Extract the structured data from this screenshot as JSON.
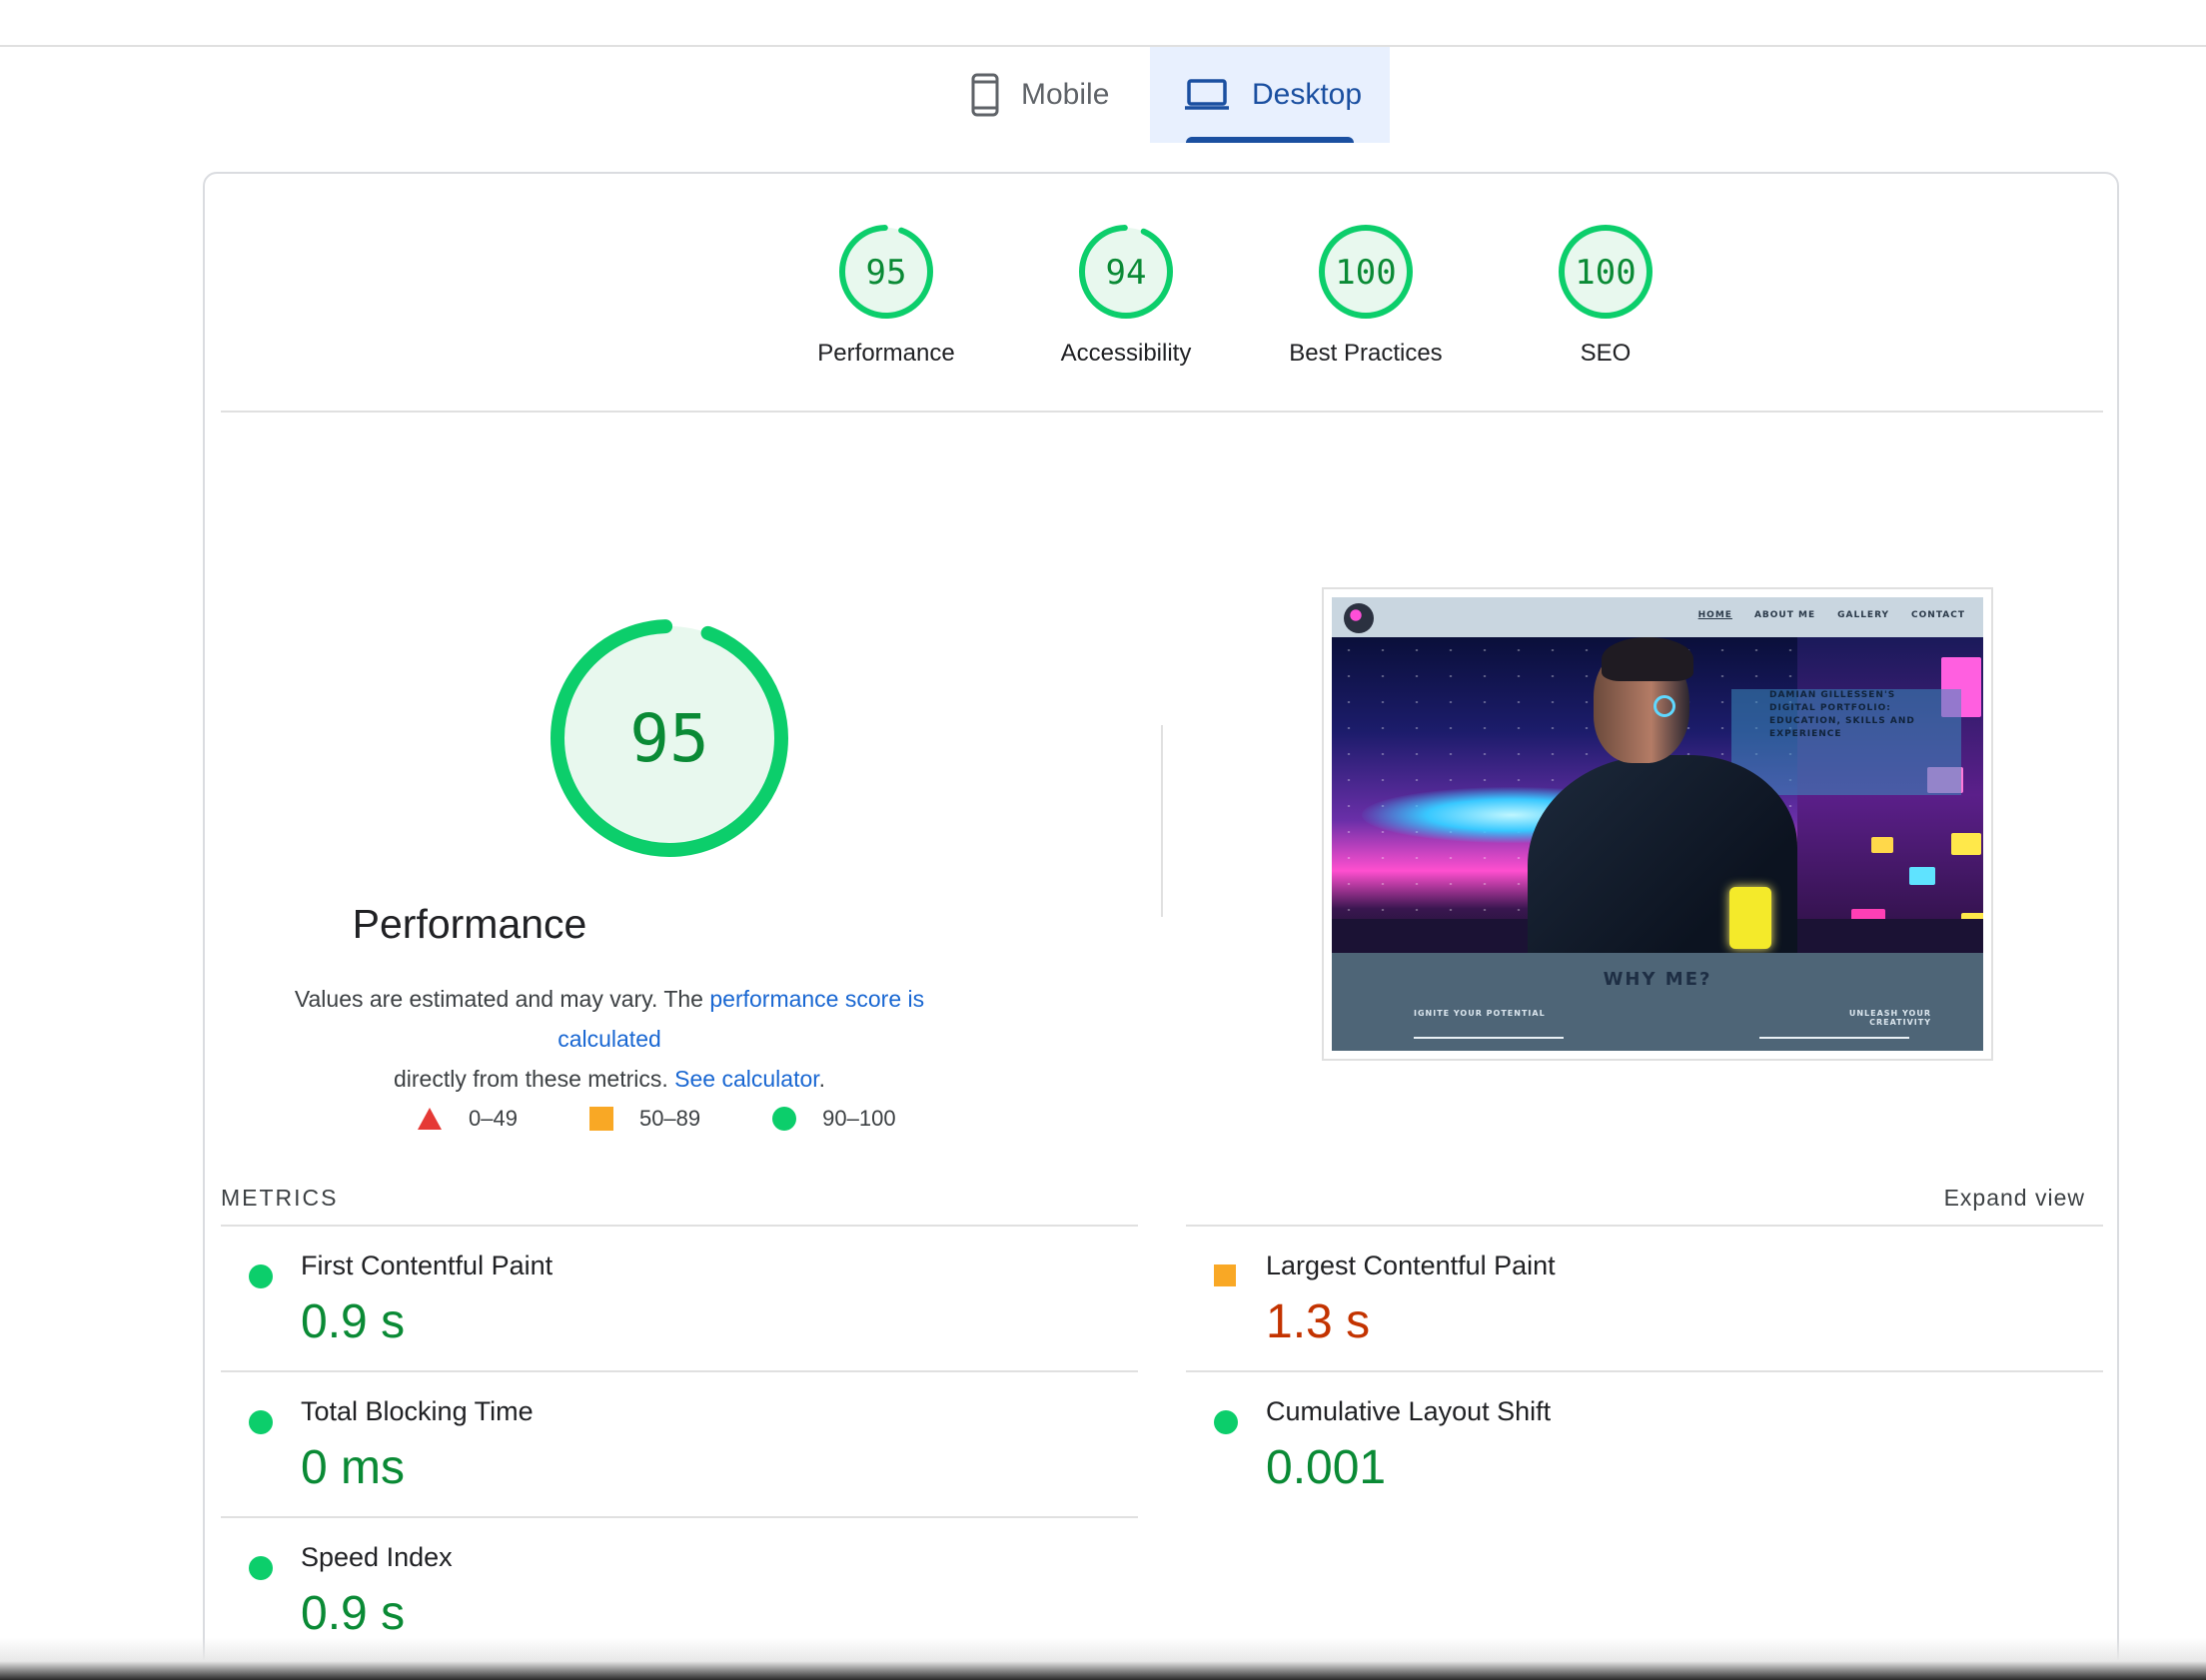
{
  "tabs": [
    {
      "label": "Mobile",
      "icon": "smartphone-icon",
      "selected": false
    },
    {
      "label": "Desktop",
      "icon": "laptop-icon",
      "selected": true
    }
  ],
  "categories": [
    {
      "score": "95",
      "label": "Performance",
      "fraction": 0.95
    },
    {
      "score": "94",
      "label": "Accessibility",
      "fraction": 0.94
    },
    {
      "score": "100",
      "label": "Best Practices",
      "fraction": 1.0
    },
    {
      "score": "100",
      "label": "SEO",
      "fraction": 1.0
    }
  ],
  "performance": {
    "score": "95",
    "fraction": 0.95,
    "title": "Performance",
    "desc_prefix": "Values are estimated and may vary. The ",
    "desc_link1": "performance score is calculated",
    "desc_middle": " directly from these metrics. ",
    "desc_link2": "See calculator",
    "desc_suffix": "."
  },
  "legend": [
    {
      "range": "0–49",
      "shape": "triangle",
      "color": "#e53935"
    },
    {
      "range": "50–89",
      "shape": "square",
      "color": "#f9a825"
    },
    {
      "range": "90–100",
      "shape": "circle",
      "color": "#0cce6b"
    }
  ],
  "screenshot": {
    "nav_links": [
      "HOME",
      "ABOUT ME",
      "GALLERY",
      "CONTACT"
    ],
    "panel_text": "DAMIAN GILLESSEN'S DIGITAL PORTFOLIO: EDUCATION, SKILLS AND EXPERIENCE",
    "why_heading": "WHY ME?",
    "sub_left": "IGNITE YOUR POTENTIAL",
    "sub_right": "UNLEASH YOUR CREATIVITY"
  },
  "metrics": {
    "title": "METRICS",
    "expand_label": "Expand view",
    "items": [
      {
        "label": "First Contentful Paint",
        "value": "0.9 s",
        "status": "good"
      },
      {
        "label": "Largest Contentful Paint",
        "value": "1.3 s",
        "status": "average"
      },
      {
        "label": "Total Blocking Time",
        "value": "0 ms",
        "status": "good"
      },
      {
        "label": "Cumulative Layout Shift",
        "value": "0.001",
        "status": "good"
      },
      {
        "label": "Speed Index",
        "value": "0.9 s",
        "status": "good"
      }
    ]
  },
  "colors": {
    "pass": "#0cce6b",
    "pass_text": "#0a8a35",
    "average": "#f9a825",
    "average_text": "#c33300",
    "fail": "#e53935",
    "accent": "#1a4fa0"
  }
}
